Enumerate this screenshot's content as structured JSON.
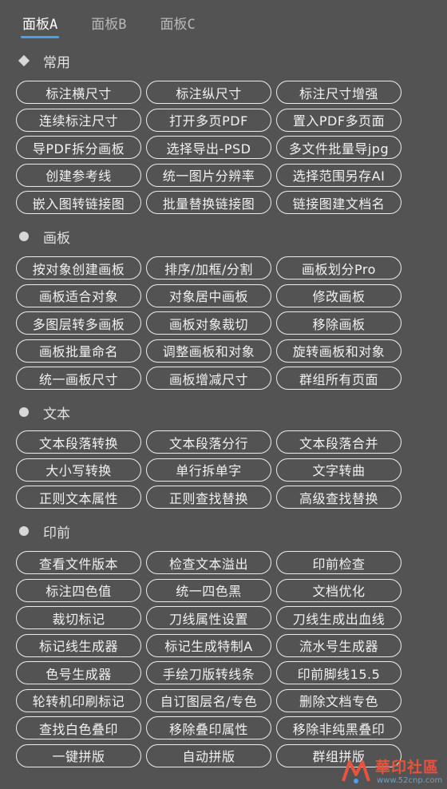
{
  "tabs": [
    {
      "label": "面板A",
      "active": true
    },
    {
      "label": "面板B",
      "active": false
    },
    {
      "label": "面板C",
      "active": false
    }
  ],
  "sections": [
    {
      "title": "常用",
      "icon": "diamond-icon",
      "buttons": [
        "标注横尺寸",
        "标注纵尺寸",
        "标注尺寸增强",
        "连续标注尺寸",
        "打开多页PDF",
        "置入PDF多页面",
        "导PDF拆分画板",
        "选择导出-PSD",
        "多文件批量导jpg",
        "创建参考线",
        "统一图片分辨率",
        "选择范围另存AI",
        "嵌入图转链接图",
        "批量替换链接图",
        "链接图建文档名"
      ]
    },
    {
      "title": "画板",
      "icon": "dot-icon",
      "buttons": [
        "按对象创建画板",
        "排序/加框/分割",
        "画板划分Pro",
        "画板适合对象",
        "对象居中画板",
        "修改画板",
        "多图层转多画板",
        "画板对象裁切",
        "移除画板",
        "画板批量命名",
        "调整画板和对象",
        "旋转画板和对象",
        "统一画板尺寸",
        "画板增减尺寸",
        "群组所有页面"
      ]
    },
    {
      "title": "文本",
      "icon": "dot-icon",
      "buttons": [
        "文本段落转换",
        "文本段落分行",
        "文本段落合并",
        "大小写转换",
        "单行拆单字",
        "文字转曲",
        "正则文本属性",
        "正则查找替换",
        "高级查找替换"
      ]
    },
    {
      "title": "印前",
      "icon": "dot-icon",
      "buttons": [
        "查看文件版本",
        "检查文本溢出",
        "印前检查",
        "标注四色值",
        "统一四色黑",
        "文档优化",
        "裁切标记",
        "刀线属性设置",
        "刀线生成出血线",
        "标记线生成器",
        "标记生成特制A",
        "流水号生成器",
        "色号生成器",
        "手绘刀版转线条",
        "印前脚线15.5",
        "轮转机印刷标记",
        "自订图层名/专色",
        "删除文档专色",
        "查找白色叠印",
        "移除叠印属性",
        "移除非纯黑叠印",
        "一键拼版",
        "自动拼版",
        "群组拼版"
      ]
    }
  ],
  "watermark": {
    "title": "華印社區",
    "url": "www.52cnp.com"
  },
  "colors": {
    "background": "#535353",
    "accent": "#4aa0ea",
    "button_border": "#ececec",
    "watermark_red": "#e8533f"
  }
}
